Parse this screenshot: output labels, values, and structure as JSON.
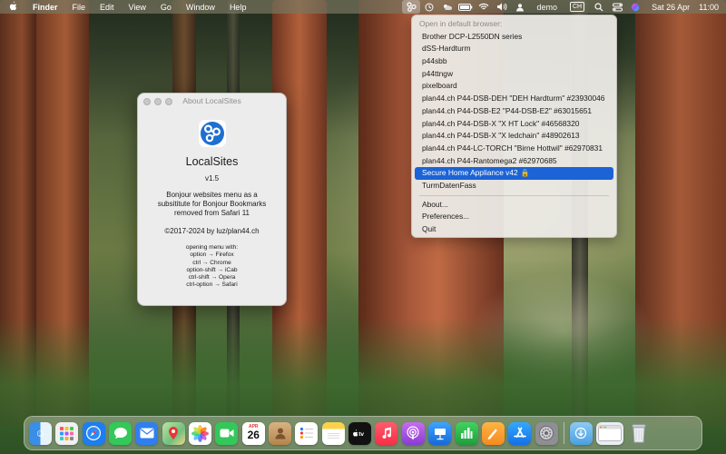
{
  "menubar": {
    "app_name": "Finder",
    "menus": [
      "File",
      "Edit",
      "View",
      "Go",
      "Window",
      "Help"
    ],
    "user": "demo",
    "input_source": "CH",
    "date": "Sat 26 Apr",
    "time": "11:00",
    "status_icons": [
      "localsites-icon",
      "time-machine-icon",
      "weather-icon",
      "battery-icon",
      "wifi-icon",
      "volume-icon",
      "user-icon",
      "keyboard-input-icon",
      "search-icon",
      "control-center-icon",
      "siri-icon"
    ]
  },
  "dropdown": {
    "header": "Open in default browser:",
    "items": [
      "Brother DCP-L2550DN series",
      "dSS-Hardturm",
      "p44sbb",
      "p44ttngw",
      "pixelboard",
      "plan44.ch P44-DSB-DEH \"DEH Hardturm\" #23930046",
      "plan44.ch P44-DSB-E2 \"P44-DSB-E2\" #63015651",
      "plan44.ch P44-DSB-X \"X HT Lock\" #46568320",
      "plan44.ch P44-DSB-X \"X ledchain\" #48902613",
      "plan44.ch P44-LC-TORCH \"Birne Hottwil\" #62970831",
      "plan44.ch P44-Rantomega2 #62970685",
      "Secure Home Appliance v42",
      "TurmDatenFass"
    ],
    "selected_index": 11,
    "footer_items": [
      "About...",
      "Preferences...",
      "Quit"
    ]
  },
  "about": {
    "window_title": "About LocalSites",
    "app_name": "LocalSites",
    "version": "v1.5",
    "description": [
      "Bonjour websites menu as a",
      "subsititute for Bonjour Bookmarks",
      "removed from Safari 11"
    ],
    "copyright": "©2017-2024 by luz/plan44.ch",
    "help_lines": [
      "opening menu with:",
      "option → Firefox",
      "ctrl → Chrome",
      "option-shift → iCab",
      "ctrl-shift → Opera",
      "ctrl-option → Safari"
    ],
    "logo_color": "#1e6fd0"
  },
  "dock": {
    "calendar": {
      "month": "APR",
      "day": "26"
    },
    "apps": [
      {
        "name": "finder-icon",
        "color": "#3a8ee6"
      },
      {
        "name": "launchpad-icon",
        "color": "#f0f0f0"
      },
      {
        "name": "safari-icon",
        "color": "#1c7ef0"
      },
      {
        "name": "messages-icon",
        "color": "#34c759"
      },
      {
        "name": "mail-icon",
        "color": "#2f7ff0"
      },
      {
        "name": "maps-icon",
        "color": "#4fb06a"
      },
      {
        "name": "photos-icon",
        "color": "#ffffff"
      },
      {
        "name": "facetime-icon",
        "color": "#34c759"
      },
      {
        "name": "calendar-icon",
        "color": "#ffffff"
      },
      {
        "name": "contacts-icon",
        "color": "#c99a5e"
      },
      {
        "name": "reminders-icon",
        "color": "#ffffff"
      },
      {
        "name": "notes-icon",
        "color": "#fbd24a"
      },
      {
        "name": "tv-icon",
        "color": "#111111"
      },
      {
        "name": "music-icon",
        "color": "#fc3c54"
      },
      {
        "name": "podcasts-icon",
        "color": "#9b4be0"
      },
      {
        "name": "keynote-icon",
        "color": "#1f8ef0"
      },
      {
        "name": "numbers-icon",
        "color": "#2fb24a"
      },
      {
        "name": "pages-icon",
        "color": "#f79a26"
      },
      {
        "name": "app-store-icon",
        "color": "#1b8cf5"
      },
      {
        "name": "system-settings-icon",
        "color": "#8e8e93"
      }
    ],
    "trailing": [
      {
        "name": "downloads-folder-icon",
        "color": "#6fb6ea"
      },
      {
        "name": "window-preview-icon",
        "color": "#e8eef5"
      },
      {
        "name": "trash-icon",
        "color": "#d9dde2"
      }
    ]
  }
}
